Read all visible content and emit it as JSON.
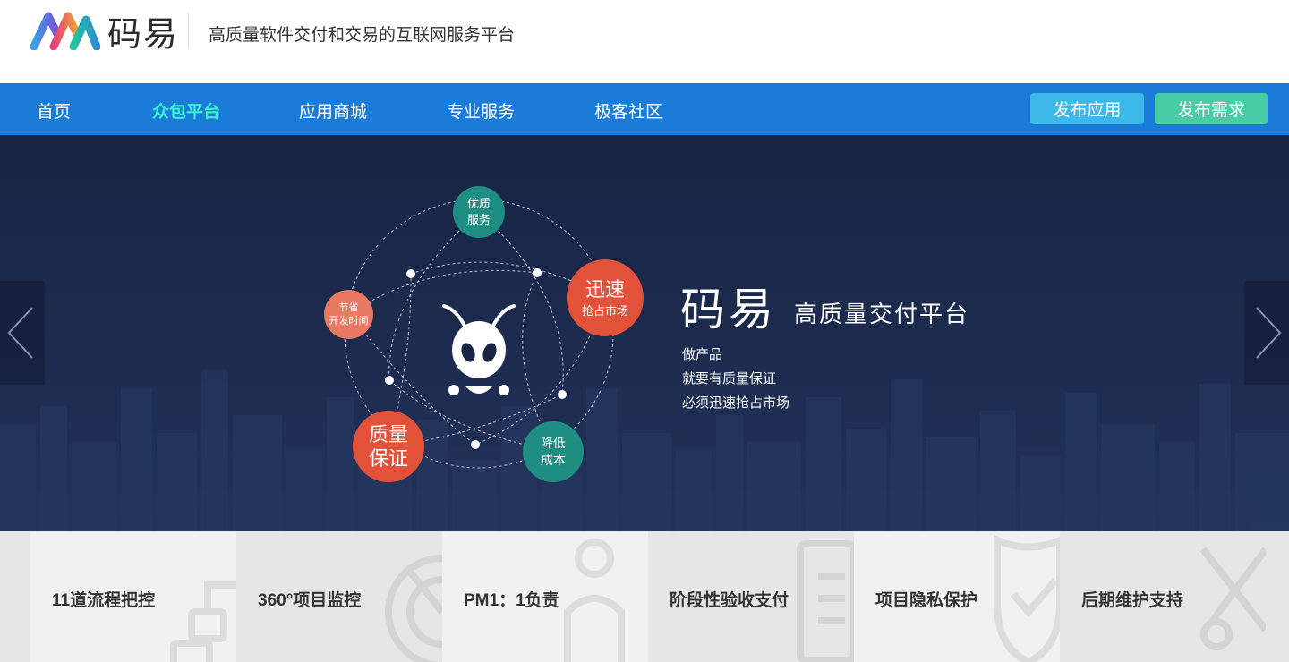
{
  "header": {
    "logo_text": "码易",
    "slogan": "高质量软件交付和交易的互联网服务平台"
  },
  "nav": {
    "items": [
      {
        "label": "首页",
        "active": false
      },
      {
        "label": "众包平台",
        "active": true
      },
      {
        "label": "应用商城",
        "active": false
      },
      {
        "label": "专业服务",
        "active": false
      },
      {
        "label": "极客社区",
        "active": false
      }
    ],
    "publish_app": "发布应用",
    "publish_req": "发布需求"
  },
  "banner": {
    "title": "码易",
    "subtitle": "高质量交付平台",
    "lines": [
      "做产品",
      "就要有质量保证",
      "必须迅速抢占市场"
    ],
    "bubbles": {
      "service_1": "优质",
      "service_2": "服务",
      "fast_1": "迅速",
      "fast_2": "抢占市场",
      "save_1": "节省",
      "save_2": "开发时间",
      "quality_1": "质量",
      "quality_2": "保证",
      "cost_1": "降低",
      "cost_2": "成本"
    }
  },
  "features": [
    "11道流程把控",
    "360°项目监控",
    "PM1：1负责",
    "阶段性验收支付",
    "项目隐私保护",
    "后期维护支持"
  ],
  "colors": {
    "nav_bg": "#1b7bd8",
    "nav_active": "#3af0d0",
    "btn_app": "#3cb9e9",
    "btn_req": "#48cca6",
    "banner_bg": "#182443",
    "teal": "#1f8e82",
    "red": "#e2513a"
  }
}
